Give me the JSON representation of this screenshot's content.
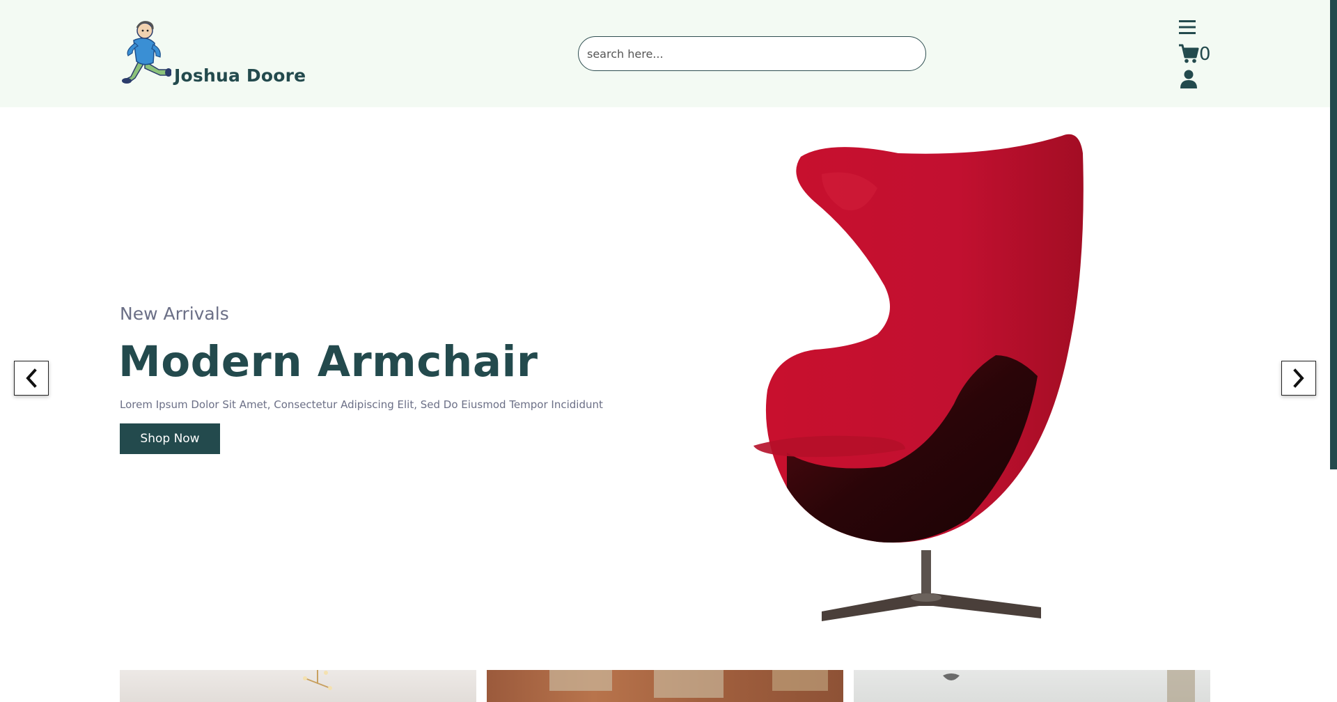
{
  "header": {
    "brand_name": "Joshua Doore",
    "logo_icon": "walking-man-mascot-icon",
    "search": {
      "placeholder": "search here...",
      "value": ""
    },
    "icons": {
      "menu": "hamburger-menu-icon",
      "cart": "shopping-cart-icon",
      "user": "user-icon"
    },
    "cart_count": "0"
  },
  "hero": {
    "subtitle": "New Arrivals",
    "title": "Modern Armchair",
    "description": "Lorem Ipsum Dolor Sit Amet, Consectetur Adipiscing Elit, Sed Do Eiusmod Tempor Incididunt",
    "cta_label": "Shop Now",
    "product_image": "red-egg-armchair",
    "prev_icon": "chevron-left-icon",
    "next_icon": "chevron-right-icon"
  },
  "categories": [
    {
      "image": "dining-room-with-chandelier"
    },
    {
      "image": "brick-loft-dining-room"
    },
    {
      "image": "white-bedroom-with-skull-decor"
    }
  ],
  "colors": {
    "primary": "#234a4d",
    "header_bg": "#f3faf3",
    "muted_text": "#6b6f86",
    "chair_red": "#c0122c"
  }
}
